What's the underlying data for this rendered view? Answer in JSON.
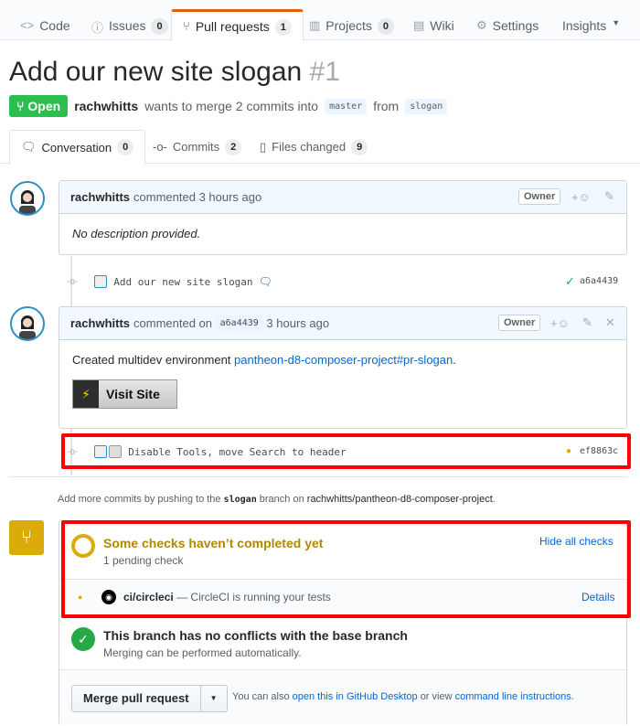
{
  "repo_nav": {
    "tabs": [
      {
        "label": "Code",
        "icon": "code-icon"
      },
      {
        "label": "Issues",
        "count": "0",
        "icon": "issue-icon"
      },
      {
        "label": "Pull requests",
        "count": "1",
        "icon": "pr-icon"
      },
      {
        "label": "Projects",
        "count": "0",
        "icon": "project-icon"
      },
      {
        "label": "Wiki",
        "icon": "book-icon"
      },
      {
        "label": "Settings",
        "icon": "gear-icon"
      },
      {
        "label": "Insights",
        "icon": "chevron-down-icon"
      }
    ]
  },
  "pr": {
    "title": "Add our new site slogan",
    "number": "#1",
    "state": "Open",
    "author": "rachwhitts",
    "merge_text": "wants to merge 2 commits into",
    "base_branch": "master",
    "from_text": "from",
    "head_branch": "slogan"
  },
  "pr_tabs": [
    {
      "label": "Conversation",
      "count": "0"
    },
    {
      "label": "Commits",
      "count": "2"
    },
    {
      "label": "Files changed",
      "count": "9"
    }
  ],
  "comment1": {
    "author": "rachwhitts",
    "action": "commented",
    "time": "3 hours ago",
    "role": "Owner",
    "body": "No description provided."
  },
  "commit1": {
    "message": "Add our new site slogan",
    "sha": "a6a4439",
    "status": "✓"
  },
  "comment2": {
    "author": "rachwhitts",
    "action": "commented on",
    "sha": "a6a4439",
    "time": "3 hours ago",
    "role": "Owner",
    "body_prefix": "Created multidev environment",
    "link": "pantheon-d8-composer-project#pr-slogan",
    "body_suffix": ".",
    "button": "Visit Site"
  },
  "commit2": {
    "message": "Disable Tools, move Search to header",
    "sha": "ef8863c",
    "status": "●"
  },
  "hint": {
    "prefix": "Add more commits by pushing to the",
    "branch": "slogan",
    "middle": "branch on",
    "repo": "rachwhitts/pantheon-d8-composer-project",
    "suffix": "."
  },
  "checks": {
    "title": "Some checks haven’t completed yet",
    "subtitle": "1 pending check",
    "hide_label": "Hide all checks",
    "items": [
      {
        "name": "ci/circleci",
        "desc": "— CircleCI is running your tests",
        "details": "Details"
      }
    ]
  },
  "conflicts": {
    "title": "This branch has no conflicts with the base branch",
    "subtitle": "Merging can be performed automatically."
  },
  "merge": {
    "button": "Merge pull request",
    "prefix": "You can also",
    "desktop_link": "open this in GitHub Desktop",
    "middle": "or view",
    "cli_link": "command line instructions",
    "suffix": "."
  },
  "colors": {
    "open_green": "#2cbe4e",
    "pending_yellow": "#dbab09",
    "success_green": "#28a745",
    "link_blue": "#0366d6",
    "highlight_red": "#ff0000"
  }
}
